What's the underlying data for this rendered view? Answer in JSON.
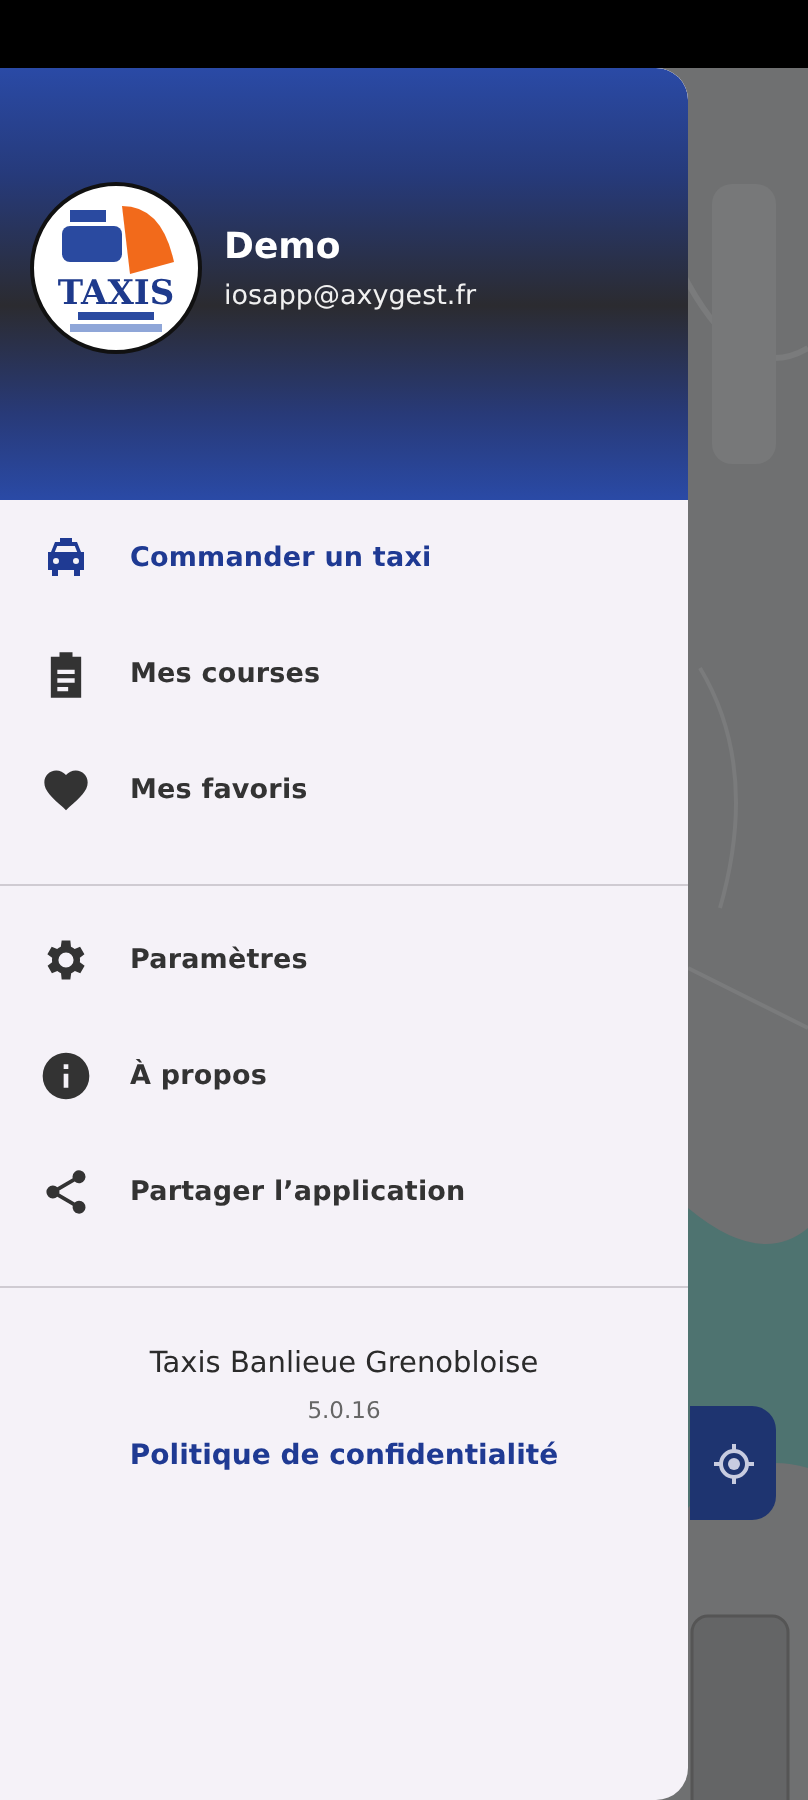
{
  "header": {
    "logo_text": "TAXIS",
    "user_name": "Demo",
    "user_email": "iosapp@axygest.fr"
  },
  "menu_groups": [
    {
      "items": [
        {
          "kind": "taxi",
          "label": "Commander un taxi",
          "selected": true
        },
        {
          "kind": "clipboard",
          "label": "Mes courses",
          "selected": false
        },
        {
          "kind": "heart",
          "label": "Mes favoris",
          "selected": false
        }
      ]
    },
    {
      "items": [
        {
          "kind": "gear",
          "label": "Paramètres",
          "selected": false
        },
        {
          "kind": "info",
          "label": "À propos",
          "selected": false
        },
        {
          "kind": "share",
          "label": "Partager l’application",
          "selected": false
        }
      ]
    }
  ],
  "footer": {
    "app_name": "Taxis Banlieue Grenobloise",
    "version": "5.0.16",
    "privacy_link": "Politique de confidentialité"
  }
}
